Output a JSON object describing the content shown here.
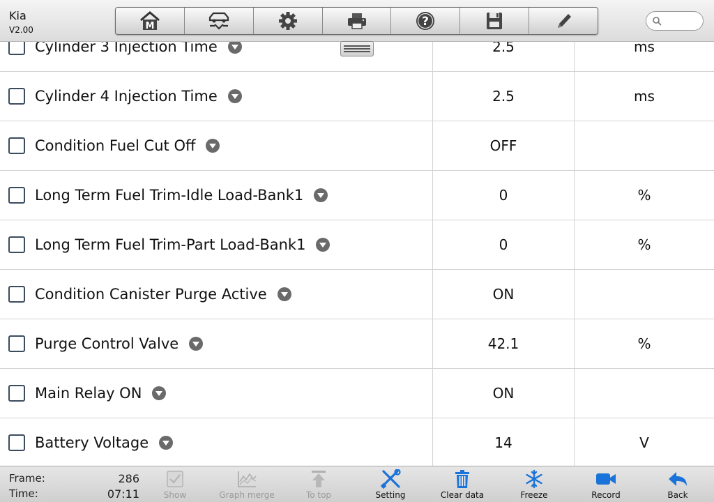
{
  "header": {
    "app_name": "Kia",
    "version": "V2.00",
    "toolbar": [
      {
        "name": "home-button",
        "icon": "home-m-icon"
      },
      {
        "name": "vehicle-button",
        "icon": "car-icon"
      },
      {
        "name": "settings-button",
        "icon": "gear-icon"
      },
      {
        "name": "print-button",
        "icon": "printer-icon"
      },
      {
        "name": "help-button",
        "icon": "help-icon"
      },
      {
        "name": "save-button",
        "icon": "floppy-icon"
      },
      {
        "name": "edit-button",
        "icon": "pencil-icon"
      }
    ],
    "search_placeholder": ""
  },
  "rows": [
    {
      "label": "Cylinder 3 Injection Time",
      "value": "2.5",
      "unit": "ms"
    },
    {
      "label": "Cylinder 4 Injection Time",
      "value": "2.5",
      "unit": "ms"
    },
    {
      "label": "Condition Fuel Cut Off",
      "value": "OFF",
      "unit": ""
    },
    {
      "label": "Long Term Fuel Trim-Idle Load-Bank1",
      "value": "0",
      "unit": "%"
    },
    {
      "label": "Long Term Fuel Trim-Part Load-Bank1",
      "value": "0",
      "unit": "%"
    },
    {
      "label": "Condition Canister Purge Active",
      "value": "ON",
      "unit": ""
    },
    {
      "label": "Purge Control Valve",
      "value": "42.1",
      "unit": "%"
    },
    {
      "label": "Main Relay ON",
      "value": "ON",
      "unit": ""
    },
    {
      "label": "Battery Voltage",
      "value": "14",
      "unit": "V"
    }
  ],
  "status": {
    "frame_label": "Frame:",
    "frame_value": "286",
    "time_label": "Time:",
    "time_value": "07:11"
  },
  "bottom_buttons": {
    "show": "Show",
    "graph_merge": "Graph merge",
    "to_top": "To top",
    "setting": "Setting",
    "clear_data": "Clear data",
    "freeze": "Freeze",
    "record": "Record",
    "back": "Back"
  },
  "colors": {
    "accent": "#1a73d9",
    "disabled": "#a8a8a8"
  }
}
